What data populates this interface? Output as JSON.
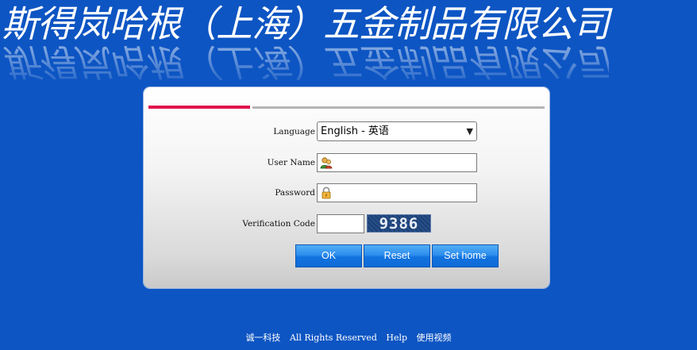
{
  "header": {
    "title": "斯得岚哈根（上海）五金制品有限公司"
  },
  "form": {
    "language_label": "Language",
    "language_value": "English - 英语",
    "username_label": "User Name",
    "password_label": "Password",
    "verification_label": "Verification Code",
    "captcha_text": "9386",
    "ok_label": "OK",
    "reset_label": "Reset",
    "sethome_label": "Set home"
  },
  "footer": {
    "company": "诚一科技",
    "rights": "All Rights Reserved",
    "help": "Help",
    "video": "使用视频"
  },
  "colors": {
    "background": "#0d55c3",
    "accent_red": "#e0144e",
    "button_blue": "#1173e0"
  }
}
